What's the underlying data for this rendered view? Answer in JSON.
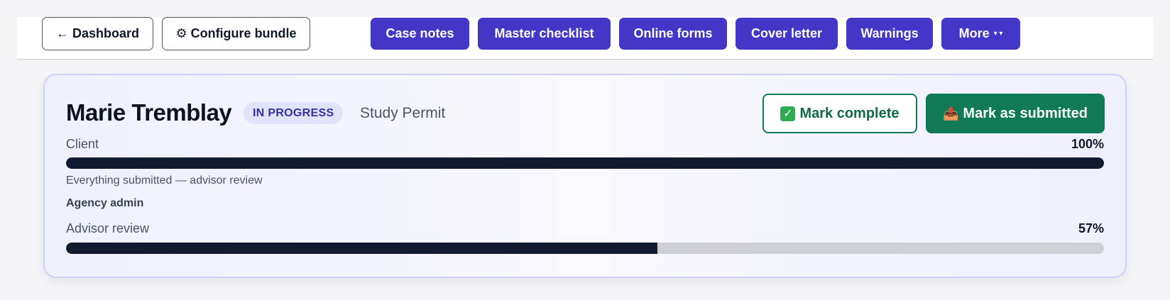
{
  "toolbar": {
    "dashboard_label": "← Dashboard",
    "configure_label": "⚙ Configure bundle",
    "nav": [
      {
        "label": "Case notes"
      },
      {
        "label": "Master checklist"
      },
      {
        "label": "Online forms"
      },
      {
        "label": "Cover letter"
      },
      {
        "label": "Warnings"
      },
      {
        "label": "More",
        "caret": "▾ ▾"
      }
    ]
  },
  "case": {
    "client_name": "Marie Tremblay",
    "status": "IN PROGRESS",
    "application_type": "Study Permit",
    "mark_complete_label": "Mark complete",
    "mark_complete_icon": "✓",
    "mark_submitted_label": "Mark as submitted",
    "mark_submitted_icon": "📤"
  },
  "progress": {
    "client": {
      "label": "Client",
      "percent_label": "100%",
      "fraction": 1.0,
      "note": "Everything submitted — advisor review"
    },
    "agency_section_label": "Agency admin",
    "advisor": {
      "label": "Advisor review",
      "percent_label": "57%",
      "fraction": 0.57
    }
  },
  "colors": {
    "nav_button": "#4437c8",
    "submit_green": "#0f7a55",
    "progress_fill": "#111a2e",
    "badge_bg": "#e1e3fb"
  }
}
